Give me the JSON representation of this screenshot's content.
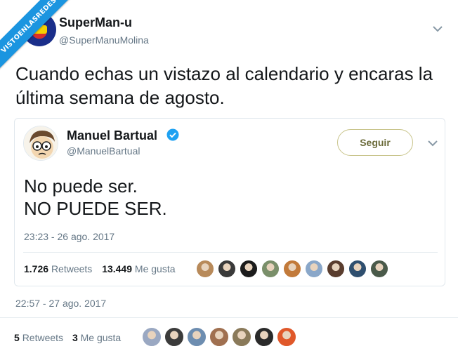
{
  "watermark": "VISTOENLASREDES",
  "tweet": {
    "author_name": "SuperMan-u",
    "author_handle": "@SuperManuMolina",
    "text": "Cuando echas un vistazo al calendario y encaras la última semana de agosto.",
    "timestamp": "22:57 - 27 ago. 2017",
    "retweets_count": "5",
    "retweets_label": "Retweets",
    "likes_count": "3",
    "likes_label": "Me gusta"
  },
  "quoted": {
    "author_name": "Manuel Bartual",
    "author_handle": "@ManuelBartual",
    "follow_label": "Seguir",
    "text_line1": "No puede ser.",
    "text_line2": "NO PUEDE SER.",
    "timestamp": "23:23 - 26 ago. 2017",
    "retweets_count": "1.726",
    "retweets_label": "Retweets",
    "likes_count": "13.449",
    "likes_label": "Me gusta"
  },
  "colors": {
    "accent": "#1b95e0",
    "follow_border": "#c8c48a",
    "muted_text": "#657786"
  },
  "quoted_liker_avatars": [
    "#b88a5a",
    "#3a3a3a",
    "#1c1c1c",
    "#7a8f6a",
    "#c27a3a",
    "#8aa7c9",
    "#5a3d2e",
    "#2f4f6f",
    "#4a5a4a"
  ],
  "liker_avatars": [
    "#9aa8c2",
    "#3b3b3b",
    "#6d8db0",
    "#a07050",
    "#8a7a5a",
    "#2a2a2a",
    "#e0582a"
  ]
}
